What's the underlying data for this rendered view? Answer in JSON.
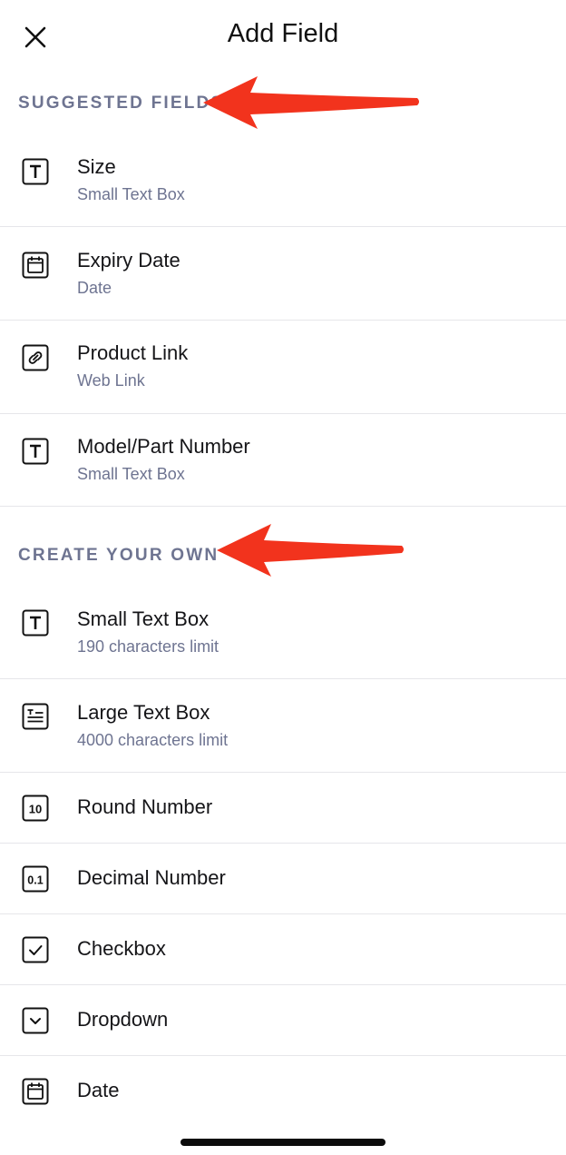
{
  "header": {
    "title": "Add Field",
    "close_icon": "close-icon"
  },
  "sections": {
    "suggested": {
      "title": "SUGGESTED FIELDS",
      "items": [
        {
          "label": "Size",
          "sub": "Small Text Box",
          "icon": "text-box-icon"
        },
        {
          "label": "Expiry Date",
          "sub": "Date",
          "icon": "calendar-icon"
        },
        {
          "label": "Product Link",
          "sub": "Web Link",
          "icon": "link-icon"
        },
        {
          "label": "Model/Part Number",
          "sub": "Small Text Box",
          "icon": "text-box-icon"
        }
      ]
    },
    "create": {
      "title": "CREATE YOUR OWN",
      "items": [
        {
          "label": "Small Text Box",
          "sub": "190 characters limit",
          "icon": "text-box-icon"
        },
        {
          "label": "Large Text Box",
          "sub": "4000 characters limit",
          "icon": "large-text-icon"
        },
        {
          "label": "Round Number",
          "icon": "round-number-icon",
          "icon_text": "10"
        },
        {
          "label": "Decimal Number",
          "icon": "decimal-number-icon",
          "icon_text": "0.1"
        },
        {
          "label": "Checkbox",
          "icon": "checkbox-icon"
        },
        {
          "label": "Dropdown",
          "icon": "dropdown-icon"
        },
        {
          "label": "Date",
          "icon": "calendar-icon"
        }
      ]
    }
  },
  "colors": {
    "section_header": "#6e7491",
    "annotation_arrow": "#f2331d",
    "subtitle": "#6e7491"
  }
}
